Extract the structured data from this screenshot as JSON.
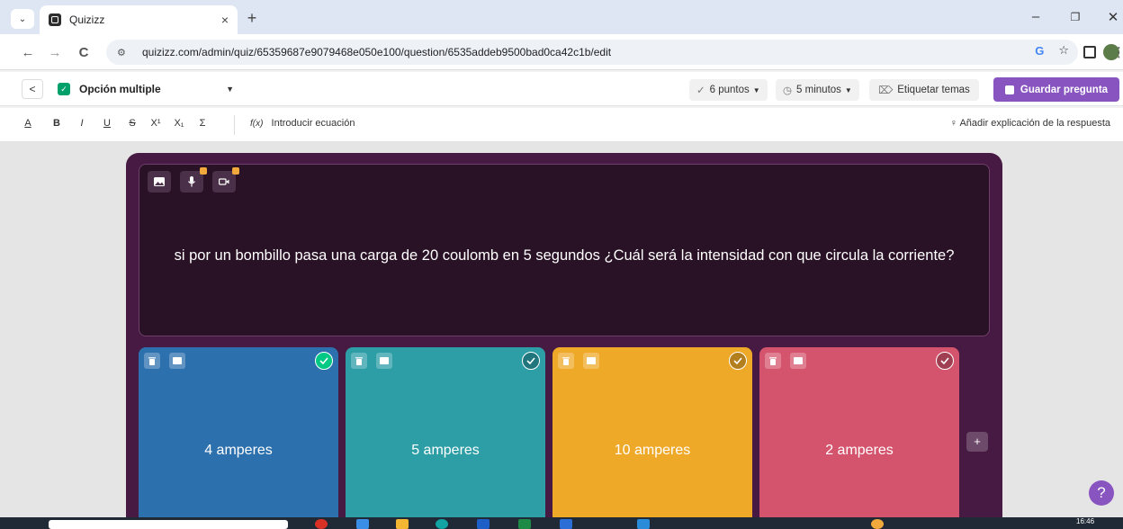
{
  "browser": {
    "tab_title": "Quizizz",
    "tab_close": "×",
    "new_tab": "+",
    "url": "quizizz.com/admin/quiz/65359687e9079468e050e100/question/6535addeb9500bad0ca42c1b/edit",
    "nav": {
      "back": "←",
      "forward": "→",
      "reload": "C"
    },
    "window": {
      "minimize": "–",
      "restore": "❐",
      "close": "✕"
    },
    "icons": {
      "google": "G",
      "star": "☆",
      "menu": "⋮"
    }
  },
  "header": {
    "back": "<",
    "question_type": "Opción multiple",
    "points": "6 puntos",
    "time": "5 minutos",
    "tag": "Etiquetar temas",
    "save": "Guardar pregunta"
  },
  "format_toolbar": {
    "buttons": [
      "A",
      "B",
      "I",
      "U",
      "S",
      "X¹",
      "X₁",
      "Σ"
    ],
    "equation_prefix": "f(x)",
    "equation": "Introducir ecuación",
    "explanation": "Añadir explicación de la respuesta"
  },
  "question": {
    "text": "si por un bombillo pasa una carga de 20 coulomb en 5 segundos ¿Cuál será la intensidad con que circula la corriente?"
  },
  "options": [
    {
      "label": "4 amperes",
      "color": "#2d70ae",
      "correct": true
    },
    {
      "label": "5 amperes",
      "color": "#2d9da6",
      "correct": false
    },
    {
      "label": "10 amperes",
      "color": "#efa929",
      "correct": false
    },
    {
      "label": "2 amperes",
      "color": "#d5546d",
      "correct": false
    }
  ],
  "add_option": "+",
  "help": "?",
  "taskbar": {
    "time": "16:46"
  }
}
